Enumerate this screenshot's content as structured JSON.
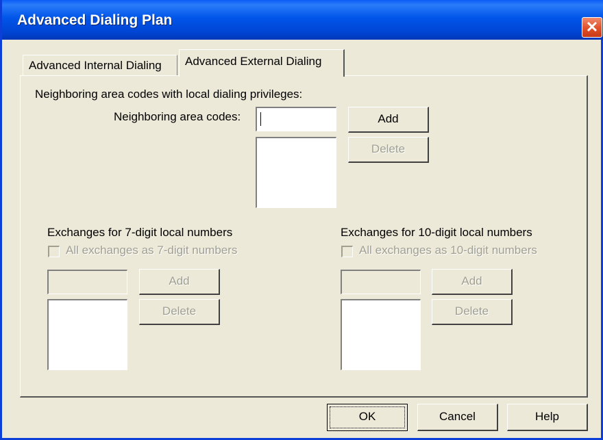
{
  "window": {
    "title": "Advanced Dialing Plan",
    "close_symbol": "✕"
  },
  "tabs": [
    {
      "label": "Advanced Internal Dialing",
      "selected": false
    },
    {
      "label": "Advanced External Dialing",
      "selected": true
    }
  ],
  "neighbors": {
    "heading": "Neighboring area codes with local dialing privileges:",
    "field_label": "Neighboring area codes:",
    "input_value": "",
    "add_label": "Add",
    "delete_label": "Delete",
    "list_items": []
  },
  "exchanges7": {
    "heading": "Exchanges for 7-digit local numbers",
    "checkbox_label": "All exchanges as 7-digit numbers",
    "checked": false,
    "add_label": "Add",
    "delete_label": "Delete"
  },
  "exchanges10": {
    "heading": "Exchanges for 10-digit local numbers",
    "checkbox_label": "All exchanges as 10-digit numbers",
    "checked": false,
    "add_label": "Add",
    "delete_label": "Delete"
  },
  "footer": {
    "ok_label": "OK",
    "cancel_label": "Cancel",
    "help_label": "Help"
  }
}
